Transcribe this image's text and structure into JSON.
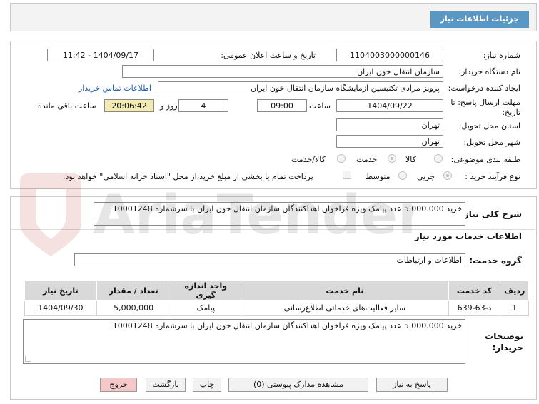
{
  "header": {
    "title": "جزئیات اطلاعات نیاز"
  },
  "form": {
    "need_number_label": "شماره نیاز:",
    "need_number": "1104003000000146",
    "announce_label": "تاریخ و ساعت اعلان عمومی:",
    "announce_value": "1404/09/17 - 11:42",
    "buyer_org_label": "نام دستگاه خریدار:",
    "buyer_org": "سازمان انتقال خون ایران",
    "creator_label": "ایجاد کننده درخواست:",
    "creator": "پرویز مرادی تکنیسین آزمایشگاه سازمان انتقال خون ایران",
    "contact_link": "اطلاعات تماس خریدار",
    "deadline_label_1": "مهلت ارسال پاسخ: تا",
    "deadline_label_2": "تاریخ:",
    "deadline_date": "1404/09/22",
    "time_label": "ساعت",
    "deadline_time": "09:00",
    "days_value": "4",
    "days_label": "روز و",
    "remaining_time": "20:06:42",
    "remaining_label": "ساعت باقی مانده",
    "province_label": "استان محل تحویل:",
    "province": "تهران",
    "city_label": "شهر محل تحویل:",
    "city": "تهران",
    "category_label": "طبقه بندی موضوعی:",
    "category_options": [
      "کالا",
      "خدمت",
      "کالا/خدمت"
    ],
    "category_selected": "خدمت",
    "process_label": "نوع فرآیند خرید :",
    "process_options": [
      "جزیی",
      "متوسط"
    ],
    "process_selected": "جزیی",
    "payment_note": "پرداخت تمام یا بخشی از مبلغ خرید،از محل \"اسناد خزانه اسلامی\" خواهد بود."
  },
  "description": {
    "label": "شرح کلی نیاز:",
    "text": "خرید 5.000.000 عدد پیامک ویژه فراخوان اهداکنندگان سازمان انتقال خون ایران با سرشماره 10001248"
  },
  "services": {
    "section_title": "اطلاعات خدمات مورد نیاز",
    "group_label": "گروه خدمت:",
    "group_value": "اطلاعات و ارتباطات",
    "columns": [
      "ردیف",
      "کد خدمت",
      "نام خدمت",
      "واحد اندازه گیری",
      "تعداد / مقدار",
      "تاریخ نیاز"
    ],
    "rows": [
      [
        "1",
        "د-63-639",
        "سایر فعالیت‌های خدماتی اطلاع‌رسانی",
        "پیامک",
        "5,000,000",
        "1404/09/30"
      ]
    ]
  },
  "buyer_notes": {
    "label_1": "توضیحات",
    "label_2": "خریدار:",
    "text": "خرید 5.000.000 عدد پیامک ویژه فراخوان اهداکنندگان سازمان انتقال خون ایران با سرشماره 10001248"
  },
  "buttons": {
    "reply": "پاسخ به نیاز",
    "attachments": "مشاهده مدارک پیوستی (0)",
    "print": "چاپ",
    "back": "بازگشت",
    "exit": "خروج"
  },
  "watermark": {
    "text": "AriaTender.net"
  },
  "colors": {
    "header_badge": "#5a97c2",
    "remaining_bg": "#f2ecb4",
    "exit_bg": "#f6c9c9",
    "link": "#1a5fb4"
  }
}
